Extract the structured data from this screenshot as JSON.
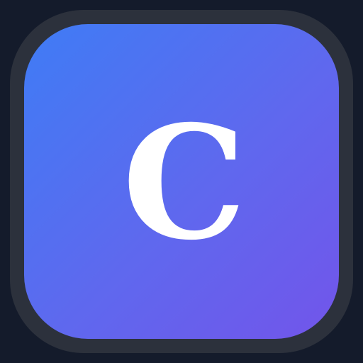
{
  "app_icon": {
    "letter": "C",
    "icon_name": "app-letter-icon",
    "colors": {
      "background": "#141b2b",
      "frame": "#2c313c",
      "gradient_start": "#3f7cf5",
      "gradient_mid": "#5f68ee",
      "gradient_end": "#7255ea",
      "letter": "#ffffff"
    }
  }
}
